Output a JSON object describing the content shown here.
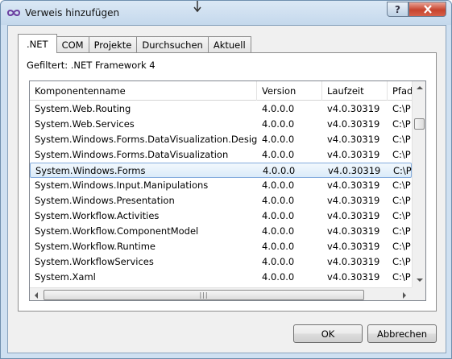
{
  "window": {
    "title": "Verweis hinzufügen",
    "help_label": "?"
  },
  "tabs": [
    {
      "label": ".NET",
      "active": true
    },
    {
      "label": "COM",
      "active": false
    },
    {
      "label": "Projekte",
      "active": false
    },
    {
      "label": "Durchsuchen",
      "active": false
    },
    {
      "label": "Aktuell",
      "active": false
    }
  ],
  "filter_label": "Gefiltert: .NET Framework 4",
  "list": {
    "columns": [
      "Komponentenname",
      "Version",
      "Laufzeit",
      "Pfad"
    ],
    "rows": [
      {
        "name": "System.Web.Routing",
        "version": "4.0.0.0",
        "runtime": "v4.0.30319",
        "path": "C:\\P"
      },
      {
        "name": "System.Web.Services",
        "version": "4.0.0.0",
        "runtime": "v4.0.30319",
        "path": "C:\\P"
      },
      {
        "name": "System.Windows.Forms.DataVisualization.Design",
        "version": "4.0.0.0",
        "runtime": "v4.0.30319",
        "path": "C:\\P"
      },
      {
        "name": "System.Windows.Forms.DataVisualization",
        "version": "4.0.0.0",
        "runtime": "v4.0.30319",
        "path": "C:\\P"
      },
      {
        "name": "System.Windows.Forms",
        "version": "4.0.0.0",
        "runtime": "v4.0.30319",
        "path": "C:\\P",
        "selected": true
      },
      {
        "name": "System.Windows.Input.Manipulations",
        "version": "4.0.0.0",
        "runtime": "v4.0.30319",
        "path": "C:\\P"
      },
      {
        "name": "System.Windows.Presentation",
        "version": "4.0.0.0",
        "runtime": "v4.0.30319",
        "path": "C:\\P"
      },
      {
        "name": "System.Workflow.Activities",
        "version": "4.0.0.0",
        "runtime": "v4.0.30319",
        "path": "C:\\P"
      },
      {
        "name": "System.Workflow.ComponentModel",
        "version": "4.0.0.0",
        "runtime": "v4.0.30319",
        "path": "C:\\P"
      },
      {
        "name": "System.Workflow.Runtime",
        "version": "4.0.0.0",
        "runtime": "v4.0.30319",
        "path": "C:\\P"
      },
      {
        "name": "System.WorkflowServices",
        "version": "4.0.0.0",
        "runtime": "v4.0.30319",
        "path": "C:\\P"
      },
      {
        "name": "System.Xaml",
        "version": "4.0.0.0",
        "runtime": "v4.0.30319",
        "path": "C:\\P"
      }
    ],
    "grip": "|||"
  },
  "buttons": {
    "ok": "OK",
    "cancel": "Abbrechen"
  }
}
